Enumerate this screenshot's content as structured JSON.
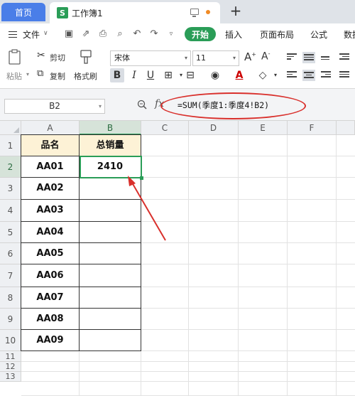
{
  "tabs": {
    "home": "首页",
    "doc_icon": "S",
    "doc_title": "工作簿1",
    "add": "+"
  },
  "menu": {
    "file": "文件",
    "start": "开始",
    "insert": "插入",
    "page_layout": "页面布局",
    "formula": "公式",
    "data": "数据"
  },
  "ribbon": {
    "cut": "剪切",
    "copy": "复制",
    "paste": "粘贴",
    "format_painter": "格式刷",
    "font_name": "宋体",
    "font_size": "11"
  },
  "formula_bar": {
    "name_box": "B2",
    "fx": "fx",
    "formula": "=SUM(季度1:季度4!B2)"
  },
  "columns": [
    "A",
    "B",
    "C",
    "D",
    "E",
    "F"
  ],
  "rows": [
    "1",
    "2",
    "3",
    "4",
    "5",
    "6",
    "7",
    "8",
    "9",
    "10",
    "11",
    "12",
    "13"
  ],
  "table": {
    "header": [
      "品名",
      "总销量"
    ],
    "rows": [
      [
        "AA01",
        "2410"
      ],
      [
        "AA02",
        ""
      ],
      [
        "AA03",
        ""
      ],
      [
        "AA04",
        ""
      ],
      [
        "AA05",
        ""
      ],
      [
        "AA06",
        ""
      ],
      [
        "AA07",
        ""
      ],
      [
        "AA08",
        ""
      ],
      [
        "AA09",
        ""
      ]
    ]
  },
  "selected_cell": "B2",
  "colors": {
    "accent_green": "#2a9d57",
    "home_tab_blue": "#4a7ee8",
    "header_fill": "#fdf2d6",
    "annotation_red": "#d9302c"
  }
}
